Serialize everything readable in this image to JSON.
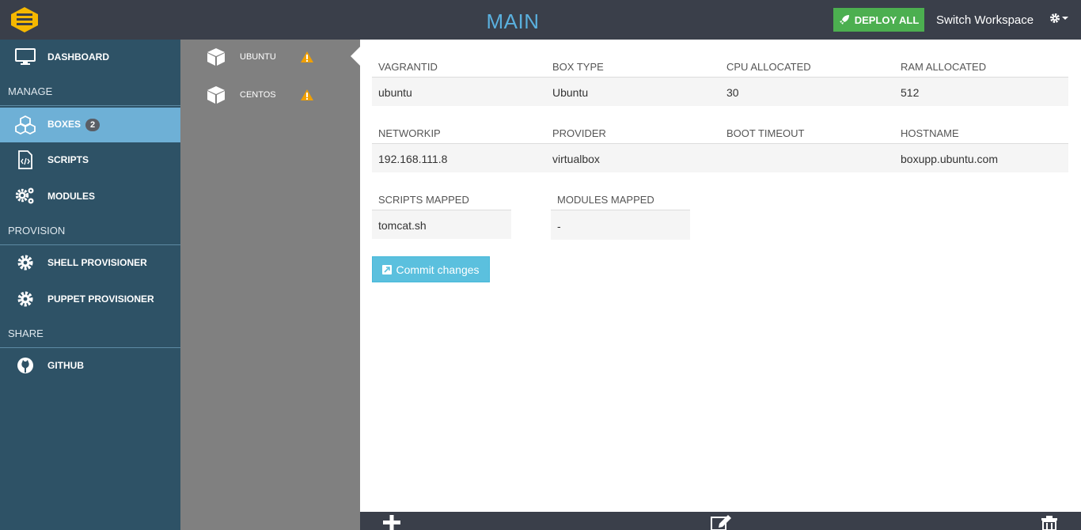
{
  "header": {
    "title": "MAIN",
    "deploy_label": "DEPLOY ALL",
    "switch_label": "Switch Workspace"
  },
  "sidebar": {
    "dashboard": "DASHBOARD",
    "manage_heading": "MANAGE",
    "boxes": "BOXES",
    "boxes_count": "2",
    "scripts": "SCRIPTS",
    "modules": "MODULES",
    "provision_heading": "PROVISION",
    "shell": "SHELL PROVISIONER",
    "puppet": "PUPPET PROVISIONER",
    "share_heading": "SHARE",
    "github": "GITHUB"
  },
  "boxes": [
    {
      "label": "UBUNTU",
      "warning": true
    },
    {
      "label": "CENTOS",
      "warning": true
    }
  ],
  "details": {
    "row1_headers": [
      "VAGRANTID",
      "BOX TYPE",
      "CPU ALLOCATED",
      "RAM ALLOCATED"
    ],
    "row1_values": [
      "ubuntu",
      "Ubuntu",
      "30",
      "512"
    ],
    "row2_headers": [
      "NETWORKIP",
      "PROVIDER",
      "BOOT TIMEOUT",
      "HOSTNAME"
    ],
    "row2_values": [
      "192.168.111.8",
      "virtualbox",
      "",
      "boxupp.ubuntu.com"
    ],
    "scripts_header": "SCRIPTS MAPPED",
    "scripts_value": "tomcat.sh",
    "modules_header": "MODULES MAPPED",
    "modules_value": "-"
  },
  "commit_label": "Commit changes",
  "colors": {
    "topbar": "#3a3f4a",
    "sidebar": "#2e5266",
    "active": "#6eb0d6",
    "deploy": "#4caf50",
    "commit": "#5bc0de",
    "title": "#5ab0de",
    "warning": "#f0a000"
  }
}
